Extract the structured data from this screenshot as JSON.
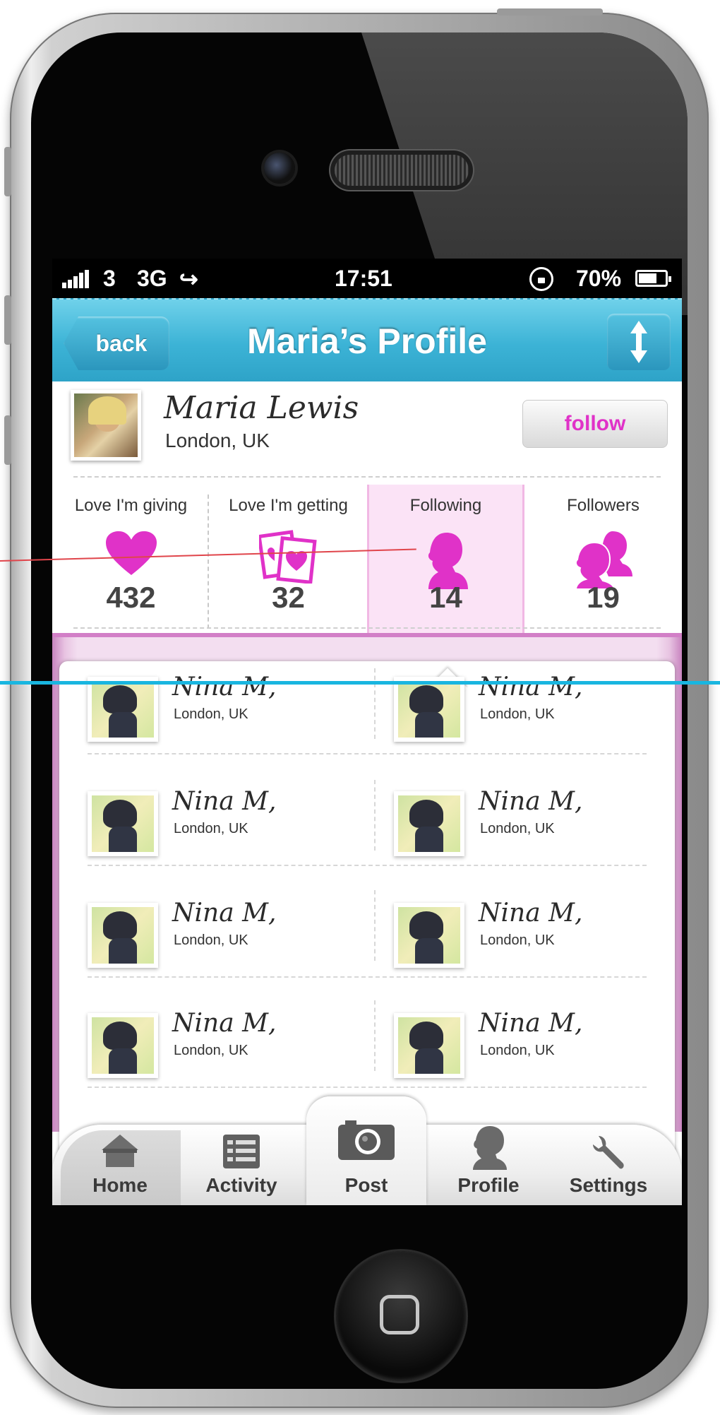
{
  "status_bar": {
    "carrier": "3",
    "network": "3G",
    "time": "17:51",
    "battery": "70%",
    "battery_level": 0.7
  },
  "nav": {
    "back_label": "back",
    "title": "Maria’s Profile"
  },
  "profile": {
    "name": "Maria Lewis",
    "location": "London, UK",
    "follow_label": "follow"
  },
  "stats": [
    {
      "label": "Love I'm giving",
      "count": "432",
      "icon": "heart-icon"
    },
    {
      "label": "Love I'm getting",
      "count": "32",
      "icon": "cards-icon"
    },
    {
      "label": "Following",
      "count": "14",
      "icon": "person-silhouette-icon"
    },
    {
      "label": "Followers",
      "count": "19",
      "icon": "people-silhouette-icon"
    }
  ],
  "list": [
    {
      "name": "Nina M,",
      "location": "London, UK"
    },
    {
      "name": "Nina M,",
      "location": "London, UK"
    },
    {
      "name": "Nina M,",
      "location": "London, UK"
    },
    {
      "name": "Nina M,",
      "location": "London, UK"
    },
    {
      "name": "Nina M,",
      "location": "London, UK"
    },
    {
      "name": "Nina M,",
      "location": "London, UK"
    },
    {
      "name": "Nina M,",
      "location": "London, UK"
    },
    {
      "name": "Nina M,",
      "location": "London, UK"
    }
  ],
  "tabs": [
    {
      "label": "Home",
      "icon": "house-icon"
    },
    {
      "label": "Activity",
      "icon": "list-icon"
    },
    {
      "label": "Post",
      "icon": "camera-icon"
    },
    {
      "label": "Profile",
      "icon": "profile-head-icon"
    },
    {
      "label": "Settings",
      "icon": "wrench-icon"
    }
  ],
  "colors": {
    "accent_pink": "#e032c8",
    "nav_blue": "#3cb3d6",
    "overlay_red": "#e0454b",
    "overlay_blue": "#19b6e0"
  }
}
